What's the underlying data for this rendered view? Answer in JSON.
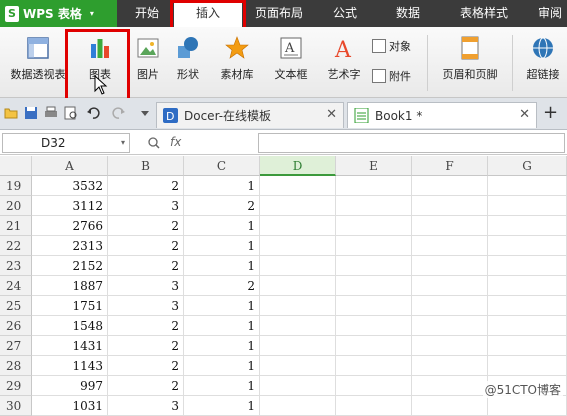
{
  "app": {
    "logo_letter": "S",
    "name": "WPS 表格",
    "arrow": "▾"
  },
  "menu_tabs": [
    "开始",
    "插入",
    "页面布局",
    "公式",
    "数据",
    "表格样式",
    "审阅"
  ],
  "active_tab": "插入",
  "ribbon": {
    "pivot_label": "数据透视表",
    "chart_label": "图表",
    "picture_label": "图片",
    "shapes_label": "形状",
    "material_label": "素材库",
    "textbox_label": "文本框",
    "arttext_label": "艺术字",
    "object_label": "对象",
    "attachment_label": "附件",
    "header_footer_label": "页眉和页脚",
    "hyperlink_label": "超链接"
  },
  "doc_tabs": [
    {
      "label": "Docer-在线模板",
      "close": "✕"
    },
    {
      "label": "Book1 *",
      "close": "✕"
    }
  ],
  "new_tab": "+",
  "formula_bar": {
    "name_box": "D32",
    "fx": "fx",
    "dropdown": "▾",
    "zoom": "🔍"
  },
  "columns": [
    "A",
    "B",
    "C",
    "D",
    "E",
    "F",
    "G"
  ],
  "rows": [
    {
      "num": "19",
      "a": "3532",
      "b": "2",
      "c": "1"
    },
    {
      "num": "20",
      "a": "3112",
      "b": "3",
      "c": "2"
    },
    {
      "num": "21",
      "a": "2766",
      "b": "2",
      "c": "1"
    },
    {
      "num": "22",
      "a": "2313",
      "b": "2",
      "c": "1"
    },
    {
      "num": "23",
      "a": "2152",
      "b": "2",
      "c": "1"
    },
    {
      "num": "24",
      "a": "1887",
      "b": "3",
      "c": "2"
    },
    {
      "num": "25",
      "a": "1751",
      "b": "3",
      "c": "1"
    },
    {
      "num": "26",
      "a": "1548",
      "b": "2",
      "c": "1"
    },
    {
      "num": "27",
      "a": "1431",
      "b": "2",
      "c": "1"
    },
    {
      "num": "28",
      "a": "1143",
      "b": "2",
      "c": "1"
    },
    {
      "num": "29",
      "a": "997",
      "b": "2",
      "c": "1"
    },
    {
      "num": "30",
      "a": "1031",
      "b": "3",
      "c": "1"
    }
  ],
  "watermark": "@51CTO博客",
  "colors": {
    "highlight_red": "#e00000",
    "wps_green": "#2e9e2e",
    "selected_col": "#dff0d8"
  }
}
